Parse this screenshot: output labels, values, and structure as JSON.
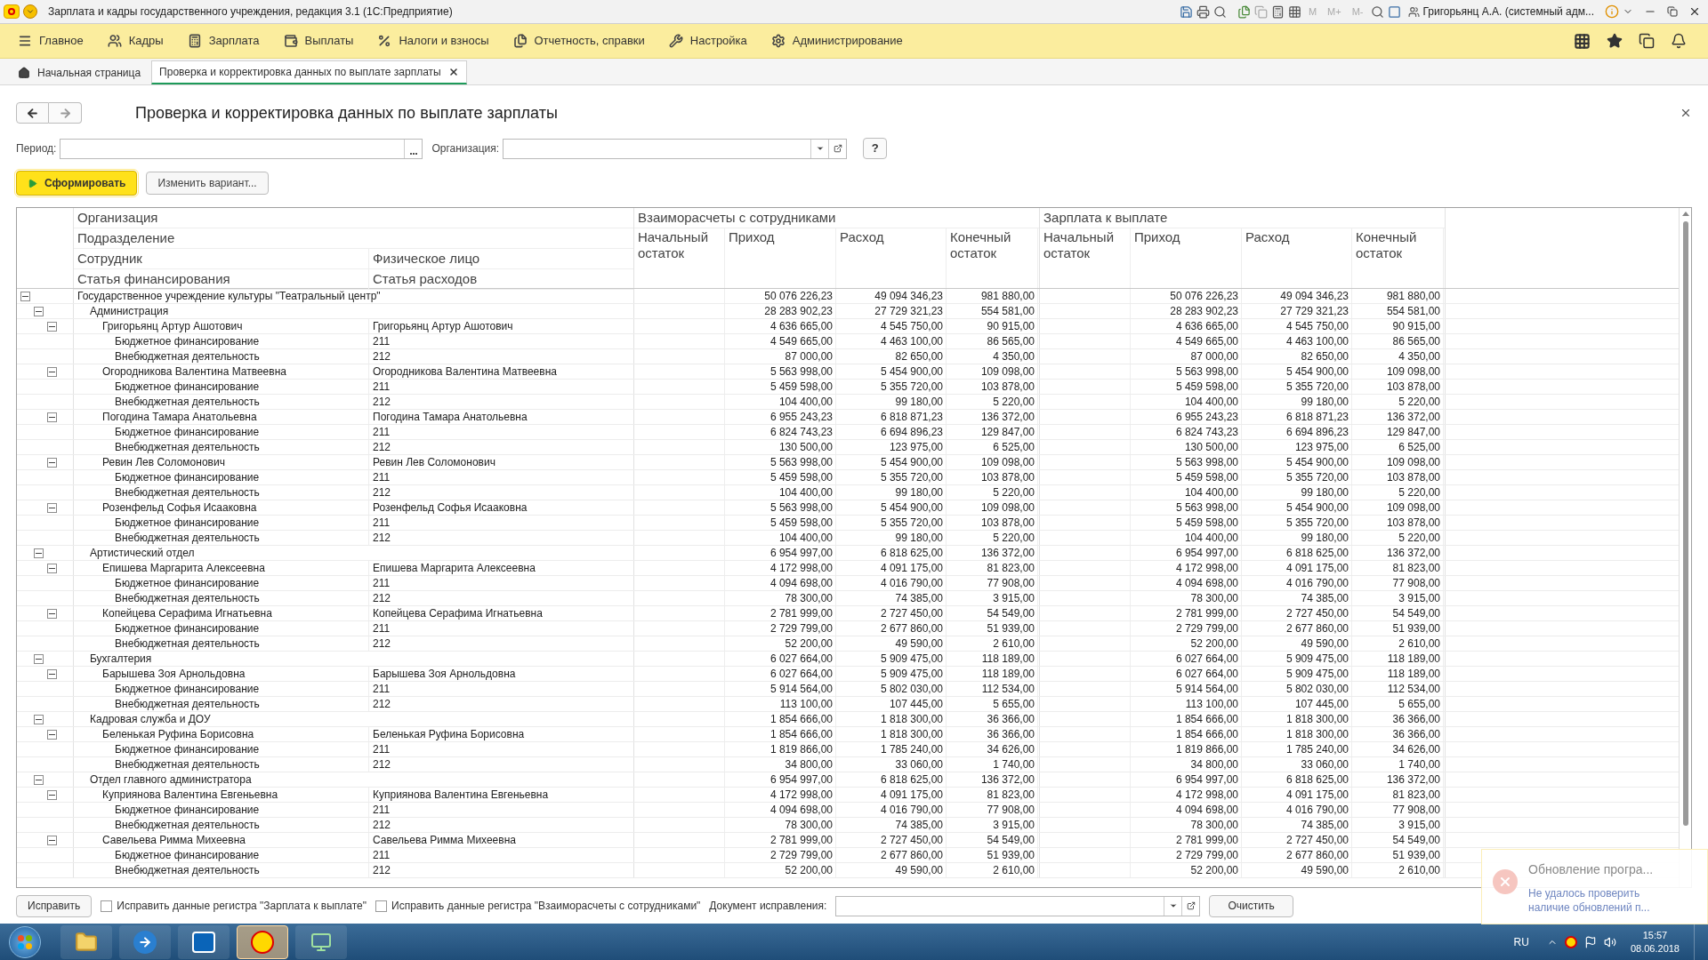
{
  "window": {
    "title": "Зарплата и кадры государственного учреждения, редакция 3.1  (1С:Предприятие)",
    "memory_buttons": [
      "M",
      "M+",
      "M-"
    ],
    "user": "Григорьянц А.А. (системный адм..."
  },
  "menu": [
    "Главное",
    "Кадры",
    "Зарплата",
    "Выплаты",
    "Налоги и взносы",
    "Отчетность, справки",
    "Настройка",
    "Администрирование"
  ],
  "tabs": [
    {
      "label": "Начальная страница",
      "selected": false
    },
    {
      "label": "Проверка и корректировка данных по выплате зарплаты",
      "selected": true
    }
  ],
  "page": {
    "title": "Проверка и корректировка данных по выплате зарплаты",
    "period_label": "Период:",
    "org_label": "Организация:",
    "help": "?",
    "generate_button": "Сформировать",
    "variant_button": "Изменить вариант..."
  },
  "table": {
    "header_left": [
      [
        "Организация"
      ],
      [
        "Подразделение"
      ],
      [
        "Сотрудник",
        "Физическое лицо"
      ],
      [
        "Статья финансирования",
        "Статья расходов"
      ]
    ],
    "groups": [
      {
        "title": "Взаиморасчеты с сотрудниками",
        "columns": [
          "Начальный остаток",
          "Приход",
          "Расход",
          "Конечный остаток"
        ]
      },
      {
        "title": "Зарплата к выплате",
        "columns": [
          "Начальный остаток",
          "Приход",
          "Расход",
          "Конечный остаток"
        ]
      }
    ],
    "rows": [
      {
        "name": "Государственное учреждение культуры \"Театральный центр\"",
        "v": [
          "50 076 226,23",
          "49 094 346,23",
          "981 880,00",
          "50 076 226,23",
          "49 094 346,23",
          "981 880,00"
        ],
        "expanded": true,
        "children": [
          {
            "name": "Администрация",
            "v": [
              "28 283 902,23",
              "27 729 321,23",
              "554 581,00",
              "28 283 902,23",
              "27 729 321,23",
              "554 581,00"
            ],
            "expanded": true,
            "children": [
              {
                "name": "Григорьянц Артур Ашотович",
                "person": "Григорьянц Артур Ашотович",
                "v": [
                  "4 636 665,00",
                  "4 545 750,00",
                  "90 915,00",
                  "4 636 665,00",
                  "4 545 750,00",
                  "90 915,00"
                ],
                "expanded": true,
                "children": [
                  {
                    "name": "Бюджетное финансирование",
                    "person": "211",
                    "v": [
                      "4 549 665,00",
                      "4 463 100,00",
                      "86 565,00",
                      "4 549 665,00",
                      "4 463 100,00",
                      "86 565,00"
                    ]
                  },
                  {
                    "name": "Внебюджетная деятельность",
                    "person": "212",
                    "v": [
                      "87 000,00",
                      "82 650,00",
                      "4 350,00",
                      "87 000,00",
                      "82 650,00",
                      "4 350,00"
                    ]
                  }
                ]
              },
              {
                "name": "Огородникова Валентина Матвеевна",
                "person": "Огородникова Валентина Матвеевна",
                "v": [
                  "5 563 998,00",
                  "5 454 900,00",
                  "109 098,00",
                  "5 563 998,00",
                  "5 454 900,00",
                  "109 098,00"
                ],
                "expanded": true,
                "children": [
                  {
                    "name": "Бюджетное финансирование",
                    "person": "211",
                    "v": [
                      "5 459 598,00",
                      "5 355 720,00",
                      "103 878,00",
                      "5 459 598,00",
                      "5 355 720,00",
                      "103 878,00"
                    ]
                  },
                  {
                    "name": "Внебюджетная деятельность",
                    "person": "212",
                    "v": [
                      "104 400,00",
                      "99 180,00",
                      "5 220,00",
                      "104 400,00",
                      "99 180,00",
                      "5 220,00"
                    ]
                  }
                ]
              },
              {
                "name": "Погодина Тамара Анатольевна",
                "person": "Погодина Тамара Анатольевна",
                "v": [
                  "6 955 243,23",
                  "6 818 871,23",
                  "136 372,00",
                  "6 955 243,23",
                  "6 818 871,23",
                  "136 372,00"
                ],
                "expanded": true,
                "children": [
                  {
                    "name": "Бюджетное финансирование",
                    "person": "211",
                    "v": [
                      "6 824 743,23",
                      "6 694 896,23",
                      "129 847,00",
                      "6 824 743,23",
                      "6 694 896,23",
                      "129 847,00"
                    ]
                  },
                  {
                    "name": "Внебюджетная деятельность",
                    "person": "212",
                    "v": [
                      "130 500,00",
                      "123 975,00",
                      "6 525,00",
                      "130 500,00",
                      "123 975,00",
                      "6 525,00"
                    ]
                  }
                ]
              },
              {
                "name": "Ревин Лев Соломонович",
                "person": "Ревин Лев Соломонович",
                "v": [
                  "5 563 998,00",
                  "5 454 900,00",
                  "109 098,00",
                  "5 563 998,00",
                  "5 454 900,00",
                  "109 098,00"
                ],
                "expanded": true,
                "children": [
                  {
                    "name": "Бюджетное финансирование",
                    "person": "211",
                    "v": [
                      "5 459 598,00",
                      "5 355 720,00",
                      "103 878,00",
                      "5 459 598,00",
                      "5 355 720,00",
                      "103 878,00"
                    ]
                  },
                  {
                    "name": "Внебюджетная деятельность",
                    "person": "212",
                    "v": [
                      "104 400,00",
                      "99 180,00",
                      "5 220,00",
                      "104 400,00",
                      "99 180,00",
                      "5 220,00"
                    ]
                  }
                ]
              },
              {
                "name": "Розенфельд Софья Исааковна",
                "person": "Розенфельд Софья Исааковна",
                "v": [
                  "5 563 998,00",
                  "5 454 900,00",
                  "109 098,00",
                  "5 563 998,00",
                  "5 454 900,00",
                  "109 098,00"
                ],
                "expanded": true,
                "children": [
                  {
                    "name": "Бюджетное финансирование",
                    "person": "211",
                    "v": [
                      "5 459 598,00",
                      "5 355 720,00",
                      "103 878,00",
                      "5 459 598,00",
                      "5 355 720,00",
                      "103 878,00"
                    ]
                  },
                  {
                    "name": "Внебюджетная деятельность",
                    "person": "212",
                    "v": [
                      "104 400,00",
                      "99 180,00",
                      "5 220,00",
                      "104 400,00",
                      "99 180,00",
                      "5 220,00"
                    ]
                  }
                ]
              }
            ]
          },
          {
            "name": "Артистический отдел",
            "v": [
              "6 954 997,00",
              "6 818 625,00",
              "136 372,00",
              "6 954 997,00",
              "6 818 625,00",
              "136 372,00"
            ],
            "expanded": true,
            "children": [
              {
                "name": "Епишева Маргарита Алексеевна",
                "person": "Епишева Маргарита Алексеевна",
                "v": [
                  "4 172 998,00",
                  "4 091 175,00",
                  "81 823,00",
                  "4 172 998,00",
                  "4 091 175,00",
                  "81 823,00"
                ],
                "expanded": true,
                "children": [
                  {
                    "name": "Бюджетное финансирование",
                    "person": "211",
                    "v": [
                      "4 094 698,00",
                      "4 016 790,00",
                      "77 908,00",
                      "4 094 698,00",
                      "4 016 790,00",
                      "77 908,00"
                    ]
                  },
                  {
                    "name": "Внебюджетная деятельность",
                    "person": "212",
                    "v": [
                      "78 300,00",
                      "74 385,00",
                      "3 915,00",
                      "78 300,00",
                      "74 385,00",
                      "3 915,00"
                    ]
                  }
                ]
              },
              {
                "name": "Копейцева Серафима Игнатьевна",
                "person": "Копейцева Серафима Игнатьевна",
                "v": [
                  "2 781 999,00",
                  "2 727 450,00",
                  "54 549,00",
                  "2 781 999,00",
                  "2 727 450,00",
                  "54 549,00"
                ],
                "expanded": true,
                "children": [
                  {
                    "name": "Бюджетное финансирование",
                    "person": "211",
                    "v": [
                      "2 729 799,00",
                      "2 677 860,00",
                      "51 939,00",
                      "2 729 799,00",
                      "2 677 860,00",
                      "51 939,00"
                    ]
                  },
                  {
                    "name": "Внебюджетная деятельность",
                    "person": "212",
                    "v": [
                      "52 200,00",
                      "49 590,00",
                      "2 610,00",
                      "52 200,00",
                      "49 590,00",
                      "2 610,00"
                    ]
                  }
                ]
              }
            ]
          },
          {
            "name": "Бухгалтерия",
            "v": [
              "6 027 664,00",
              "5 909 475,00",
              "118 189,00",
              "6 027 664,00",
              "5 909 475,00",
              "118 189,00"
            ],
            "expanded": true,
            "children": [
              {
                "name": "Барышева Зоя Арнольдовна",
                "person": "Барышева Зоя Арнольдовна",
                "v": [
                  "6 027 664,00",
                  "5 909 475,00",
                  "118 189,00",
                  "6 027 664,00",
                  "5 909 475,00",
                  "118 189,00"
                ],
                "expanded": true,
                "children": [
                  {
                    "name": "Бюджетное финансирование",
                    "person": "211",
                    "v": [
                      "5 914 564,00",
                      "5 802 030,00",
                      "112 534,00",
                      "5 914 564,00",
                      "5 802 030,00",
                      "112 534,00"
                    ]
                  },
                  {
                    "name": "Внебюджетная деятельность",
                    "person": "212",
                    "v": [
                      "113 100,00",
                      "107 445,00",
                      "5 655,00",
                      "113 100,00",
                      "107 445,00",
                      "5 655,00"
                    ]
                  }
                ]
              }
            ]
          },
          {
            "name": "Кадровая служба и ДОУ",
            "v": [
              "1 854 666,00",
              "1 818 300,00",
              "36 366,00",
              "1 854 666,00",
              "1 818 300,00",
              "36 366,00"
            ],
            "expanded": true,
            "children": [
              {
                "name": "Беленькая Руфина Борисовна",
                "person": "Беленькая Руфина Борисовна",
                "v": [
                  "1 854 666,00",
                  "1 818 300,00",
                  "36 366,00",
                  "1 854 666,00",
                  "1 818 300,00",
                  "36 366,00"
                ],
                "expanded": true,
                "children": [
                  {
                    "name": "Бюджетное финансирование",
                    "person": "211",
                    "v": [
                      "1 819 866,00",
                      "1 785 240,00",
                      "34 626,00",
                      "1 819 866,00",
                      "1 785 240,00",
                      "34 626,00"
                    ]
                  },
                  {
                    "name": "Внебюджетная деятельность",
                    "person": "212",
                    "v": [
                      "34 800,00",
                      "33 060,00",
                      "1 740,00",
                      "34 800,00",
                      "33 060,00",
                      "1 740,00"
                    ]
                  }
                ]
              }
            ]
          },
          {
            "name": "Отдел главного администратора",
            "v": [
              "6 954 997,00",
              "6 818 625,00",
              "136 372,00",
              "6 954 997,00",
              "6 818 625,00",
              "136 372,00"
            ],
            "expanded": true,
            "children": [
              {
                "name": "Куприянова Валентина Евгеньевна",
                "person": "Куприянова Валентина Евгеньевна",
                "v": [
                  "4 172 998,00",
                  "4 091 175,00",
                  "81 823,00",
                  "4 172 998,00",
                  "4 091 175,00",
                  "81 823,00"
                ],
                "expanded": true,
                "children": [
                  {
                    "name": "Бюджетное финансирование",
                    "person": "211",
                    "v": [
                      "4 094 698,00",
                      "4 016 790,00",
                      "77 908,00",
                      "4 094 698,00",
                      "4 016 790,00",
                      "77 908,00"
                    ]
                  },
                  {
                    "name": "Внебюджетная деятельность",
                    "person": "212",
                    "v": [
                      "78 300,00",
                      "74 385,00",
                      "3 915,00",
                      "78 300,00",
                      "74 385,00",
                      "3 915,00"
                    ]
                  }
                ]
              },
              {
                "name": "Савельева Римма Михеевна",
                "person": "Савельева Римма Михеевна",
                "v": [
                  "2 781 999,00",
                  "2 727 450,00",
                  "54 549,00",
                  "2 781 999,00",
                  "2 727 450,00",
                  "54 549,00"
                ],
                "expanded": true,
                "children": [
                  {
                    "name": "Бюджетное финансирование",
                    "person": "211",
                    "v": [
                      "2 729 799,00",
                      "2 677 860,00",
                      "51 939,00",
                      "2 729 799,00",
                      "2 677 860,00",
                      "51 939,00"
                    ]
                  },
                  {
                    "name": "Внебюджетная деятельность",
                    "person": "212",
                    "v": [
                      "52 200,00",
                      "49 590,00",
                      "2 610,00",
                      "52 200,00",
                      "49 590,00",
                      "2 610,00"
                    ]
                  }
                ]
              }
            ]
          }
        ]
      }
    ]
  },
  "bottom": {
    "fix_button": "Исправить",
    "checkboxes": [
      {
        "label": "Исправить данные регистра \"Зарплата к выплате\"",
        "checked": false
      },
      {
        "label": "Исправить данные регистра \"Взаиморасчеты с сотрудниками\"",
        "checked": false
      }
    ],
    "doc_label": "Документ исправления:",
    "clear_button": "Очистить"
  },
  "notification": {
    "title": "Обновление програ...",
    "text": "Не удалось проверить наличие обновлений п..."
  },
  "taskbar": {
    "language": "RU",
    "time": "15:57",
    "date": "08.06.2018"
  }
}
